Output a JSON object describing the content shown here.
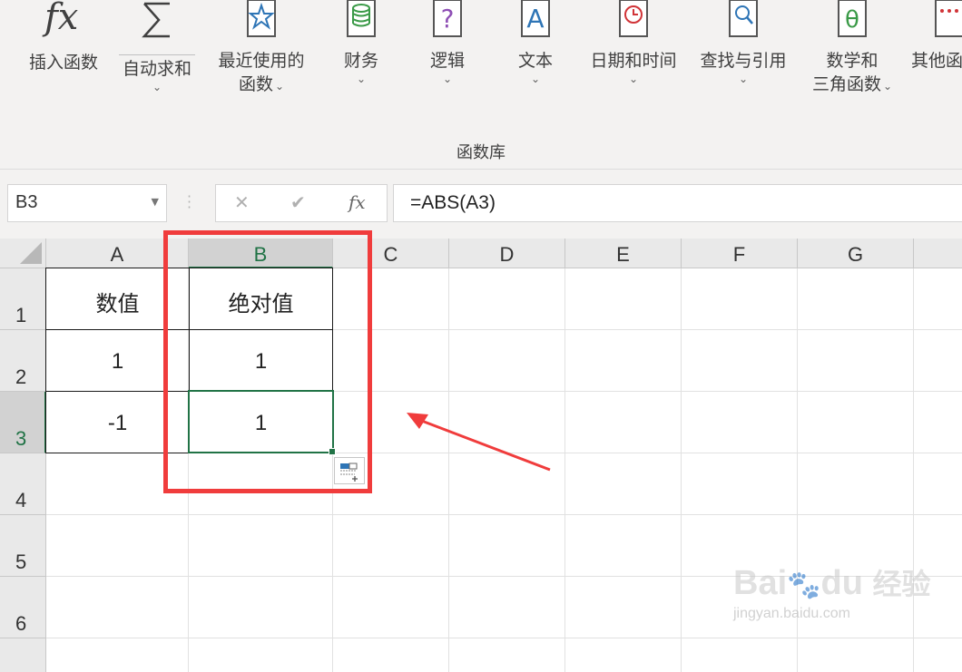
{
  "ribbon": {
    "buttons": [
      {
        "label": "插入函数",
        "icon": "fx-icon"
      },
      {
        "label": "自动求和",
        "icon": "sigma-icon"
      },
      {
        "label_line1": "最近使用的",
        "label_line2": "函数",
        "icon": "star-book-icon"
      },
      {
        "label": "财务",
        "icon": "database-book-icon"
      },
      {
        "label": "逻辑",
        "icon": "question-book-icon"
      },
      {
        "label": "文本",
        "icon": "text-book-icon"
      },
      {
        "label": "日期和时间",
        "icon": "clock-book-icon"
      },
      {
        "label": "查找与引用",
        "icon": "magnifier-book-icon"
      },
      {
        "label_line1": "数学和",
        "label_line2": "三角函数",
        "icon": "theta-book-icon"
      },
      {
        "label": "其他函",
        "icon": "more-book-icon"
      }
    ],
    "group_label": "函数库"
  },
  "formula_bar": {
    "name_box": "B3",
    "cancel_glyph": "✕",
    "enter_glyph": "✔",
    "fx_glyph": "fx",
    "formula": "=ABS(A3)"
  },
  "grid": {
    "columns": [
      "A",
      "B",
      "C",
      "D",
      "E",
      "F",
      "G"
    ],
    "rows": [
      "1",
      "2",
      "3",
      "4",
      "5",
      "6"
    ],
    "selected_column": "B",
    "selected_row": "3",
    "cells": {
      "A1": "数值",
      "B1": "绝对值",
      "A2": "1",
      "B2": "1",
      "A3": "-1",
      "B3": "1"
    }
  },
  "annotation": {
    "highlight_color": "#f03c3c"
  },
  "accent_color": "#217346",
  "watermark": {
    "brand": "Bai",
    "brand2": "du",
    "cn": "经验",
    "url": "jingyan.baidu.com"
  }
}
